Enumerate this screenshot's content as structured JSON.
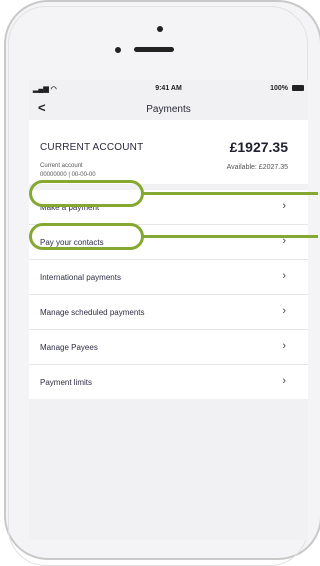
{
  "status_bar": {
    "signal": "▂▄▆ ◠",
    "time": "9:41 AM",
    "battery": "100%"
  },
  "nav": {
    "back": "<",
    "title": "Payments"
  },
  "account": {
    "name": "CURRENT ACCOUNT",
    "type": "Current account",
    "number": "00000000 | 00-00-00",
    "balance": "£1927.35",
    "available": "Available: £2027.35"
  },
  "menu": {
    "items": [
      {
        "label": "Make a payment",
        "chevron": "›"
      },
      {
        "label": "Pay your contacts",
        "chevron": "›"
      },
      {
        "label": "International payments",
        "chevron": "›"
      },
      {
        "label": "Manage scheduled payments",
        "chevron": "›"
      },
      {
        "label": "Manage Payees",
        "chevron": "›"
      },
      {
        "label": "Payment limits",
        "chevron": "›"
      }
    ]
  },
  "colors": {
    "highlight": "#84a832",
    "screen_bg": "#f1f1f3",
    "text": "#2e2e45"
  }
}
